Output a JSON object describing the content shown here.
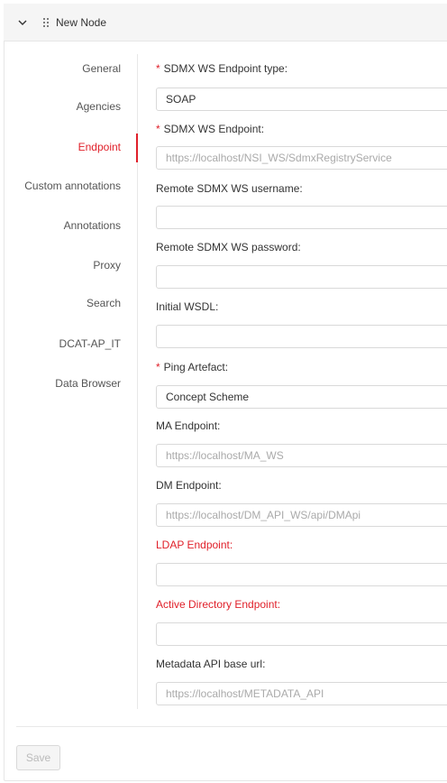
{
  "node": {
    "title": "New Node"
  },
  "sidebar": {
    "items": [
      {
        "label": "General"
      },
      {
        "label": "Agencies"
      },
      {
        "label": "Endpoint"
      },
      {
        "label": "Custom annotations"
      },
      {
        "label": "Annotations"
      },
      {
        "label": "Proxy"
      },
      {
        "label": "Search"
      },
      {
        "label": "DCAT-AP_IT"
      },
      {
        "label": "Data Browser"
      }
    ],
    "active": "Endpoint"
  },
  "form": {
    "required_mark": "*",
    "endpoint_type": {
      "label": "SDMX WS Endpoint type:",
      "value": "SOAP"
    },
    "endpoint": {
      "label": "SDMX WS Endpoint:",
      "value": "",
      "placeholder": "https://localhost/NSI_WS/SdmxRegistryService"
    },
    "ws_username": {
      "label": "Remote SDMX WS username:",
      "value": "",
      "placeholder": ""
    },
    "ws_password": {
      "label": "Remote SDMX WS password:",
      "value": "",
      "placeholder": ""
    },
    "initial_wsdl": {
      "label": "Initial WSDL:",
      "value": "",
      "placeholder": ""
    },
    "ping_artefact": {
      "label": "Ping Artefact:",
      "value": "Concept Scheme"
    },
    "ma_endpoint": {
      "label": "MA Endpoint:",
      "value": "",
      "placeholder": "https://localhost/MA_WS"
    },
    "dm_endpoint": {
      "label": "DM Endpoint:",
      "value": "",
      "placeholder": "https://localhost/DM_API_WS/api/DMApi"
    },
    "ldap_endpoint": {
      "label": "LDAP Endpoint:",
      "value": "",
      "placeholder": ""
    },
    "ad_endpoint": {
      "label": "Active Directory Endpoint:",
      "value": "",
      "placeholder": ""
    },
    "metadata_api": {
      "label": "Metadata API base url:",
      "value": "",
      "placeholder": "https://localhost/METADATA_API"
    }
  },
  "footer": {
    "save_label": "Save"
  },
  "colors": {
    "accent": "#e0202a",
    "border": "#d9d9d9",
    "header_bg": "#f5f5f5"
  }
}
